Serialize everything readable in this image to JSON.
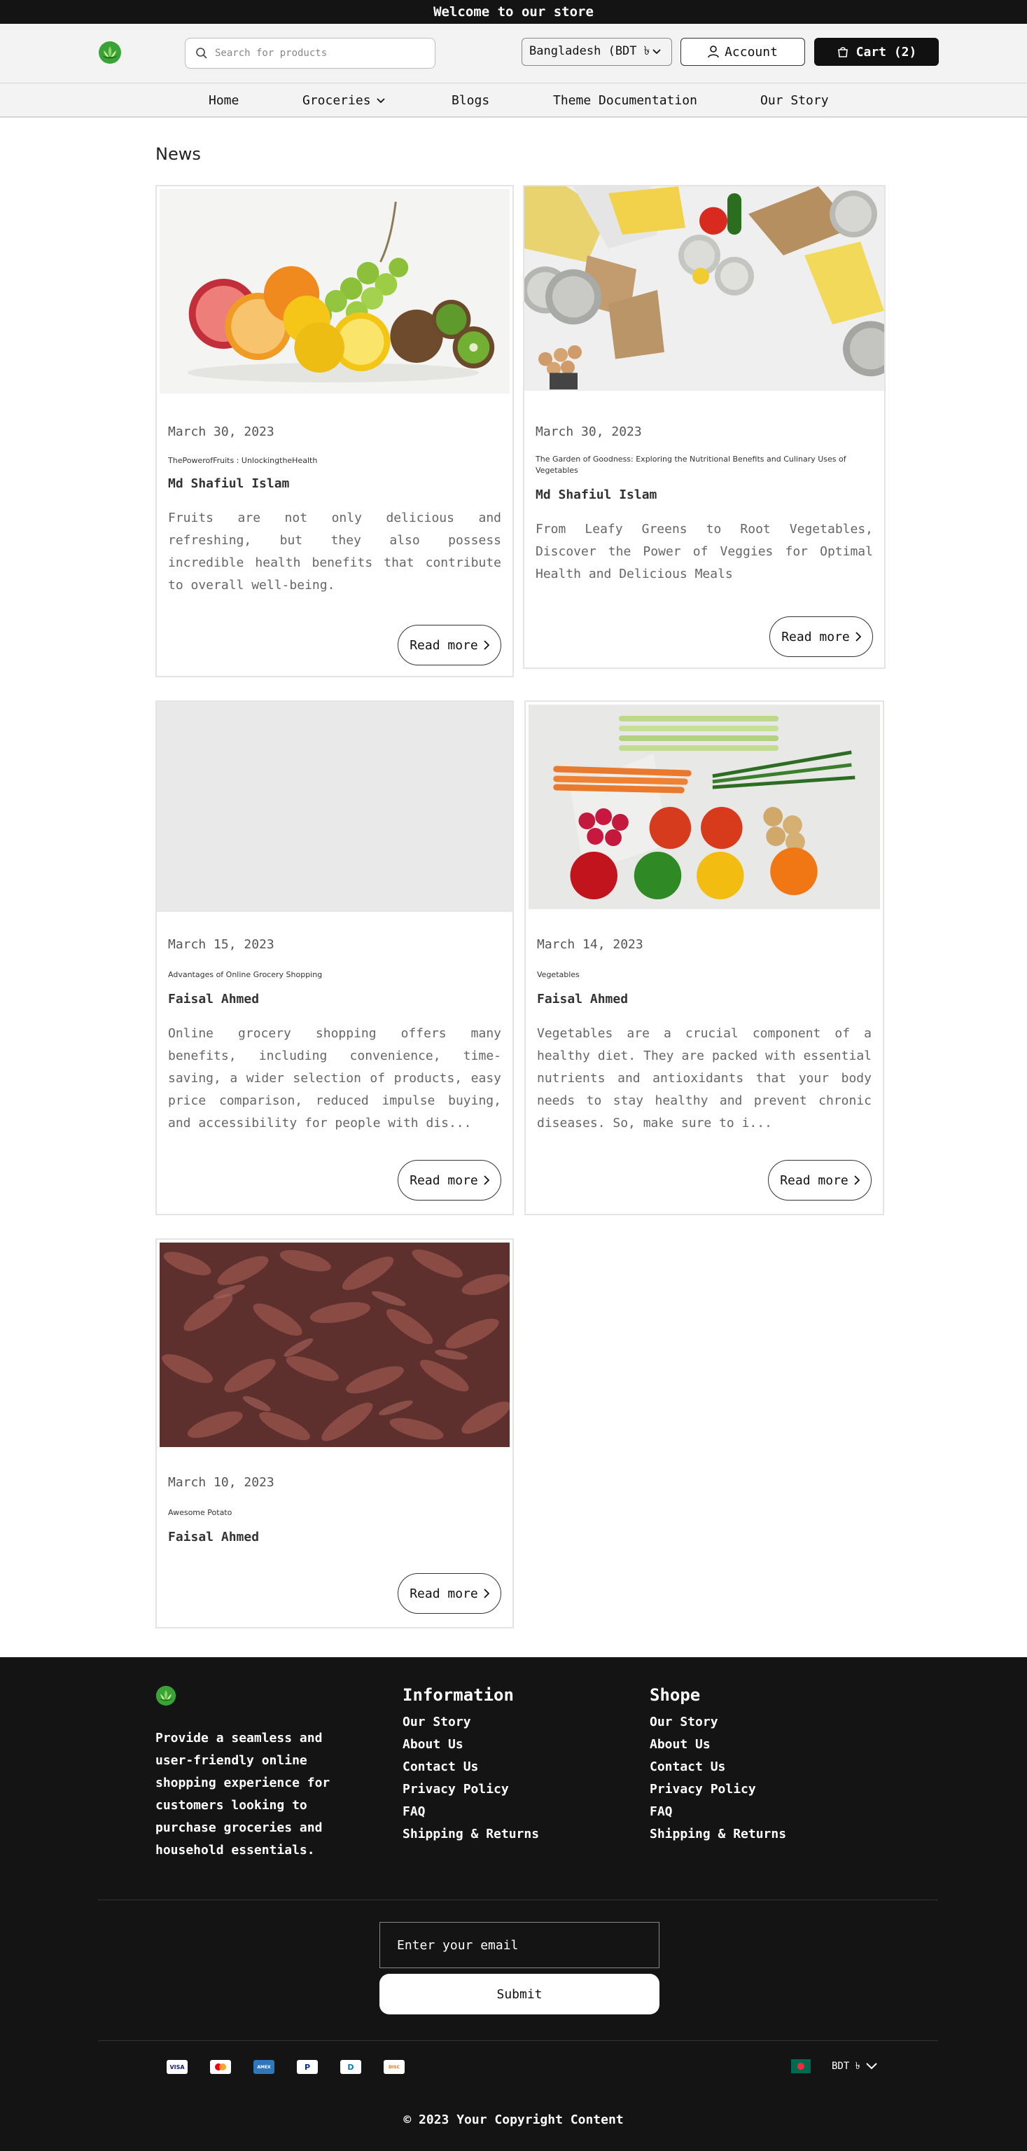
{
  "announcement": "Welcome to our store",
  "header": {
    "search_placeholder": "Search for products",
    "country": "Bangladesh (BDT ৳",
    "account_label": "Account",
    "cart_label": "Cart (2)"
  },
  "nav": {
    "items": [
      "Home",
      "Groceries",
      "Blogs",
      "Theme Documentation",
      "Our Story"
    ]
  },
  "page": {
    "title": "News"
  },
  "articles": [
    {
      "date": "March 30, 2023",
      "subtitle": "ThePowerofFruits : UnlockingtheHealth",
      "author": "Md Shafiul Islam",
      "excerpt": "Fruits are not only delicious and refreshing, but they also possess incredible health benefits that contribute to overall well-being.",
      "button": "Read more"
    },
    {
      "date": "March 30, 2023",
      "subtitle": "The Garden of Goodness: Exploring the Nutritional Benefits and Culinary Uses of Vegetables",
      "author": "Md Shafiul Islam",
      "excerpt": "From Leafy Greens to Root Vegetables, Discover the Power of Veggies for Optimal Health and Delicious Meals",
      "button": "Read more"
    },
    {
      "date": "March 15, 2023",
      "subtitle": "Advantages of Online Grocery Shopping",
      "author": "Faisal Ahmed",
      "excerpt": "Online grocery shopping offers many benefits, including convenience, time-saving, a wider selection of products, easy price comparison, reduced impulse buying, and accessibility for people with dis...",
      "button": "Read more"
    },
    {
      "date": "March 14, 2023",
      "subtitle": "Vegetables",
      "author": "Faisal Ahmed",
      "excerpt": "Vegetables are a crucial component of a healthy diet. They are packed with essential nutrients and antioxidants that your body needs to stay healthy and prevent chronic diseases. So, make sure to i...",
      "button": "Read more"
    },
    {
      "date": "March 10, 2023",
      "subtitle": "Awesome Potato",
      "author": "Faisal Ahmed",
      "button": "Read more"
    }
  ],
  "footer": {
    "about": "Provide a seamless and user-friendly online shopping experience for customers looking to purchase groceries and household essentials.",
    "information": {
      "title": "Information",
      "links": [
        "Our Story",
        "About Us",
        "Contact Us",
        "Privacy Policy",
        "FAQ",
        "Shipping & Returns"
      ]
    },
    "shope": {
      "title": "Shope",
      "links": [
        "Our Story",
        "About Us",
        "Contact Us",
        "Privacy Policy",
        "FAQ",
        "Shipping & Returns"
      ]
    },
    "email_placeholder": "Enter your email",
    "submit_label": "Submit",
    "payment_icons": [
      "VISA",
      "MC",
      "AMEX",
      "P",
      "D",
      "DISC"
    ],
    "currency": "BDT ৳",
    "copyright": "© 2023 Your Copyright Content"
  },
  "colors": {
    "dark": "#141414",
    "header_bg": "#f3f3f3",
    "logo_green": "#3aa335"
  }
}
